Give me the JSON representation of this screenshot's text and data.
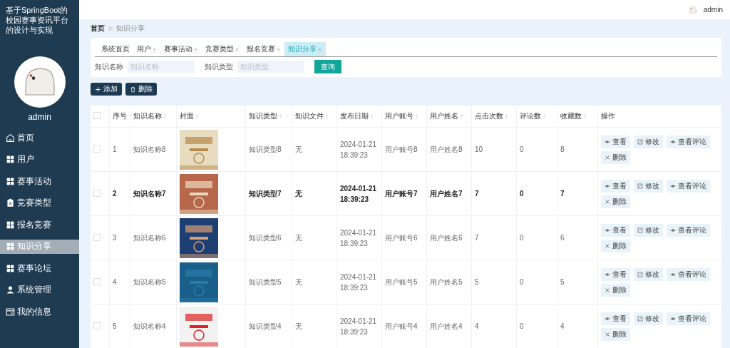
{
  "sidebar": {
    "title": "基于SpringBoot的校园赛事资讯平台的设计与实现",
    "user": "admin",
    "items": [
      {
        "label": "首页",
        "kind": "home",
        "selected": false
      },
      {
        "label": "用户",
        "kind": "grid",
        "selected": false
      },
      {
        "label": "赛事活动",
        "kind": "grid",
        "selected": false
      },
      {
        "label": "竞赛类型",
        "kind": "clipboard",
        "selected": false
      },
      {
        "label": "报名竞赛",
        "kind": "grid",
        "selected": false
      },
      {
        "label": "知识分享",
        "kind": "grid",
        "selected": true
      },
      {
        "label": "赛事论坛",
        "kind": "grid",
        "selected": false
      },
      {
        "label": "系统管理",
        "kind": "person",
        "selected": false
      },
      {
        "label": "我的信息",
        "kind": "card",
        "selected": false
      }
    ]
  },
  "header": {
    "user": "admin"
  },
  "breadcrumb": [
    "首页",
    "知识分享"
  ],
  "tabs": [
    {
      "label": "系统首页",
      "closable": false,
      "selected": false
    },
    {
      "label": "用户",
      "closable": true,
      "selected": false
    },
    {
      "label": "赛事活动",
      "closable": true,
      "selected": false
    },
    {
      "label": "竞赛类型",
      "closable": true,
      "selected": false
    },
    {
      "label": "报名竞赛",
      "closable": true,
      "selected": false
    },
    {
      "label": "知识分享",
      "closable": true,
      "selected": true
    }
  ],
  "search": {
    "fields": [
      {
        "label": "知识名称",
        "placeholder": "知识名称"
      },
      {
        "label": "知识类型",
        "placeholder": "知识类型"
      }
    ],
    "button": "查询"
  },
  "actions": [
    {
      "label": "添加",
      "kind": "add"
    },
    {
      "label": "删除",
      "kind": "delete"
    }
  ],
  "table": {
    "select_all_checked": false,
    "columns": [
      {
        "label": "序号",
        "sortable": false
      },
      {
        "label": "知识名称",
        "sortable": true
      },
      {
        "label": "封面",
        "sortable": true
      },
      {
        "label": "知识类型",
        "sortable": true
      },
      {
        "label": "知识文件",
        "sortable": true
      },
      {
        "label": "发布日期",
        "sortable": true
      },
      {
        "label": "用户账号",
        "sortable": true
      },
      {
        "label": "用户姓名",
        "sortable": true
      },
      {
        "label": "点击次数",
        "sortable": true
      },
      {
        "label": "评论数",
        "sortable": true
      },
      {
        "label": "收藏数",
        "sortable": true
      },
      {
        "label": "操作",
        "sortable": false
      }
    ],
    "rows": [
      {
        "checked": false,
        "index": "1",
        "name": "知识名称8",
        "type": "知识类型8",
        "file": "无",
        "date": "2024-01-21 18:39:23",
        "account": "用户账号8",
        "username": "用户姓名8",
        "clicks": "10",
        "comments": "0",
        "favorites": "8",
        "selected": false,
        "buttons": [
          {
            "label": "查看",
            "kind": "view"
          },
          {
            "label": "修改",
            "kind": "edit"
          },
          {
            "label": "查看评论",
            "kind": "view"
          },
          {
            "label": "删除",
            "kind": "delete"
          }
        ]
      },
      {
        "checked": false,
        "index": "2",
        "name": "知识名称7",
        "type": "知识类型7",
        "file": "无",
        "date": "2024-01-21 18:39:23",
        "account": "用户账号7",
        "username": "用户姓名7",
        "clicks": "7",
        "comments": "0",
        "favorites": "7",
        "selected": true,
        "buttons": [
          {
            "label": "查看",
            "kind": "view"
          },
          {
            "label": "修改",
            "kind": "edit"
          },
          {
            "label": "查看评论",
            "kind": "view"
          },
          {
            "label": "删除",
            "kind": "delete"
          }
        ]
      },
      {
        "checked": false,
        "index": "3",
        "name": "知识名称6",
        "type": "知识类型6",
        "file": "无",
        "date": "2024-01-21 18:39:23",
        "account": "用户账号6",
        "username": "用户姓名6",
        "clicks": "7",
        "comments": "0",
        "favorites": "6",
        "selected": false,
        "buttons": [
          {
            "label": "查看",
            "kind": "view"
          },
          {
            "label": "修改",
            "kind": "edit"
          },
          {
            "label": "查看评论",
            "kind": "view"
          },
          {
            "label": "删除",
            "kind": "delete"
          }
        ]
      },
      {
        "checked": false,
        "index": "4",
        "name": "知识名称5",
        "type": "知识类型5",
        "file": "无",
        "date": "2024-01-21 18:39:23",
        "account": "用户账号5",
        "username": "用户姓名5",
        "clicks": "5",
        "comments": "0",
        "favorites": "5",
        "selected": false,
        "buttons": [
          {
            "label": "查看",
            "kind": "view"
          },
          {
            "label": "修改",
            "kind": "edit"
          },
          {
            "label": "查看评论",
            "kind": "view"
          },
          {
            "label": "删除",
            "kind": "delete"
          }
        ]
      },
      {
        "checked": false,
        "index": "5",
        "name": "知识名称4",
        "type": "知识类型4",
        "file": "无",
        "date": "2024-01-21 18:39:23",
        "account": "用户账号4",
        "username": "用户姓名4",
        "clicks": "4",
        "comments": "0",
        "favorites": "4",
        "selected": false,
        "buttons": [
          {
            "label": "查看",
            "kind": "view"
          },
          {
            "label": "修改",
            "kind": "edit"
          },
          {
            "label": "查看评论",
            "kind": "view"
          },
          {
            "label": "删除",
            "kind": "delete"
          }
        ]
      }
    ]
  }
}
